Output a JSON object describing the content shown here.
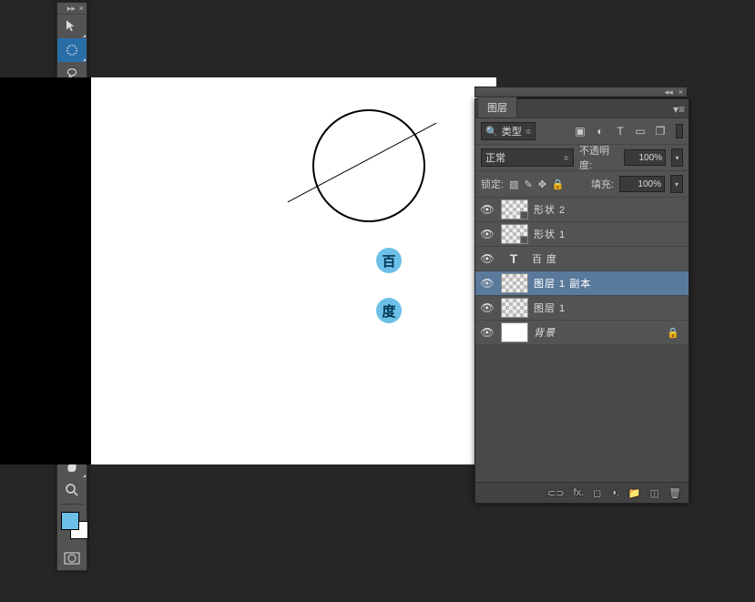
{
  "toolbar": {
    "header_collapse": "▸▸",
    "header_close": "×"
  },
  "canvas": {
    "badge1": "百",
    "badge2": "度"
  },
  "panel": {
    "pre_collapse": "◂◂",
    "pre_close": "×",
    "tab": "图层",
    "menu_icon": "▾≡",
    "filter_label": "类型",
    "filter_search": "🔍",
    "filter_arrow": "≑",
    "icon_image": "▣",
    "icon_adjust": "◐",
    "icon_text": "T",
    "icon_shape": "▭",
    "icon_smart": "❐",
    "blend_mode": "正常",
    "blend_arrow": "≑",
    "opacity_label": "不透明度:",
    "opacity_value": "100%",
    "opacity_arrow": "▾",
    "lock_label": "锁定:",
    "lock_icon1": "▨",
    "lock_icon2": "✎",
    "lock_icon3": "✥",
    "lock_icon4": "🔒",
    "fill_label": "填充:",
    "fill_value": "100%",
    "fill_arrow": "▾",
    "layers": [
      {
        "name": "形状 2",
        "type": "shape"
      },
      {
        "name": "形状 1",
        "type": "shape"
      },
      {
        "name": "百 度",
        "type": "text"
      },
      {
        "name": "图层 1 副本",
        "type": "raster",
        "selected": true
      },
      {
        "name": "图层 1",
        "type": "raster"
      },
      {
        "name": "背景",
        "type": "bg",
        "locked": true
      }
    ],
    "eye": "👁",
    "footer": {
      "link": "⊂⊃",
      "fx": "fx.",
      "mask": "◻",
      "adjust": "◑.",
      "folder": "📁",
      "new": "◫",
      "trash": "🗑"
    }
  }
}
